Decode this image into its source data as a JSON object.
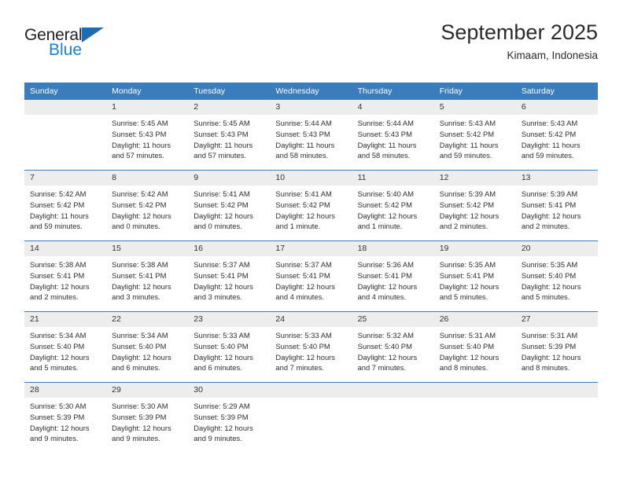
{
  "logo": {
    "word_general": "General",
    "word_blue": "Blue",
    "triangle": "blue-triangle-icon"
  },
  "header": {
    "title": "September 2025",
    "subtitle": "Kimaam, Indonesia"
  },
  "colors": {
    "header_blue": "#3a7dbf",
    "logo_blue": "#1b7fd4",
    "daynum_band": "#ededed",
    "text": "#2e2e2e"
  },
  "weekdays": [
    "Sunday",
    "Monday",
    "Tuesday",
    "Wednesday",
    "Thursday",
    "Friday",
    "Saturday"
  ],
  "weeks": [
    [
      {
        "day": "",
        "blank": true,
        "sunrise": "",
        "sunset": "",
        "daylight_1": "",
        "daylight_2": ""
      },
      {
        "day": "1",
        "sunrise": "Sunrise: 5:45 AM",
        "sunset": "Sunset: 5:43 PM",
        "daylight_1": "Daylight: 11 hours",
        "daylight_2": "and 57 minutes."
      },
      {
        "day": "2",
        "sunrise": "Sunrise: 5:45 AM",
        "sunset": "Sunset: 5:43 PM",
        "daylight_1": "Daylight: 11 hours",
        "daylight_2": "and 57 minutes."
      },
      {
        "day": "3",
        "sunrise": "Sunrise: 5:44 AM",
        "sunset": "Sunset: 5:43 PM",
        "daylight_1": "Daylight: 11 hours",
        "daylight_2": "and 58 minutes."
      },
      {
        "day": "4",
        "sunrise": "Sunrise: 5:44 AM",
        "sunset": "Sunset: 5:43 PM",
        "daylight_1": "Daylight: 11 hours",
        "daylight_2": "and 58 minutes."
      },
      {
        "day": "5",
        "sunrise": "Sunrise: 5:43 AM",
        "sunset": "Sunset: 5:42 PM",
        "daylight_1": "Daylight: 11 hours",
        "daylight_2": "and 59 minutes."
      },
      {
        "day": "6",
        "sunrise": "Sunrise: 5:43 AM",
        "sunset": "Sunset: 5:42 PM",
        "daylight_1": "Daylight: 11 hours",
        "daylight_2": "and 59 minutes."
      }
    ],
    [
      {
        "day": "7",
        "sunrise": "Sunrise: 5:42 AM",
        "sunset": "Sunset: 5:42 PM",
        "daylight_1": "Daylight: 11 hours",
        "daylight_2": "and 59 minutes."
      },
      {
        "day": "8",
        "sunrise": "Sunrise: 5:42 AM",
        "sunset": "Sunset: 5:42 PM",
        "daylight_1": "Daylight: 12 hours",
        "daylight_2": "and 0 minutes."
      },
      {
        "day": "9",
        "sunrise": "Sunrise: 5:41 AM",
        "sunset": "Sunset: 5:42 PM",
        "daylight_1": "Daylight: 12 hours",
        "daylight_2": "and 0 minutes."
      },
      {
        "day": "10",
        "sunrise": "Sunrise: 5:41 AM",
        "sunset": "Sunset: 5:42 PM",
        "daylight_1": "Daylight: 12 hours",
        "daylight_2": "and 1 minute."
      },
      {
        "day": "11",
        "sunrise": "Sunrise: 5:40 AM",
        "sunset": "Sunset: 5:42 PM",
        "daylight_1": "Daylight: 12 hours",
        "daylight_2": "and 1 minute."
      },
      {
        "day": "12",
        "sunrise": "Sunrise: 5:39 AM",
        "sunset": "Sunset: 5:42 PM",
        "daylight_1": "Daylight: 12 hours",
        "daylight_2": "and 2 minutes."
      },
      {
        "day": "13",
        "sunrise": "Sunrise: 5:39 AM",
        "sunset": "Sunset: 5:41 PM",
        "daylight_1": "Daylight: 12 hours",
        "daylight_2": "and 2 minutes."
      }
    ],
    [
      {
        "day": "14",
        "sunrise": "Sunrise: 5:38 AM",
        "sunset": "Sunset: 5:41 PM",
        "daylight_1": "Daylight: 12 hours",
        "daylight_2": "and 2 minutes."
      },
      {
        "day": "15",
        "sunrise": "Sunrise: 5:38 AM",
        "sunset": "Sunset: 5:41 PM",
        "daylight_1": "Daylight: 12 hours",
        "daylight_2": "and 3 minutes."
      },
      {
        "day": "16",
        "sunrise": "Sunrise: 5:37 AM",
        "sunset": "Sunset: 5:41 PM",
        "daylight_1": "Daylight: 12 hours",
        "daylight_2": "and 3 minutes."
      },
      {
        "day": "17",
        "sunrise": "Sunrise: 5:37 AM",
        "sunset": "Sunset: 5:41 PM",
        "daylight_1": "Daylight: 12 hours",
        "daylight_2": "and 4 minutes."
      },
      {
        "day": "18",
        "sunrise": "Sunrise: 5:36 AM",
        "sunset": "Sunset: 5:41 PM",
        "daylight_1": "Daylight: 12 hours",
        "daylight_2": "and 4 minutes."
      },
      {
        "day": "19",
        "sunrise": "Sunrise: 5:35 AM",
        "sunset": "Sunset: 5:41 PM",
        "daylight_1": "Daylight: 12 hours",
        "daylight_2": "and 5 minutes."
      },
      {
        "day": "20",
        "sunrise": "Sunrise: 5:35 AM",
        "sunset": "Sunset: 5:40 PM",
        "daylight_1": "Daylight: 12 hours",
        "daylight_2": "and 5 minutes."
      }
    ],
    [
      {
        "day": "21",
        "sunrise": "Sunrise: 5:34 AM",
        "sunset": "Sunset: 5:40 PM",
        "daylight_1": "Daylight: 12 hours",
        "daylight_2": "and 5 minutes."
      },
      {
        "day": "22",
        "sunrise": "Sunrise: 5:34 AM",
        "sunset": "Sunset: 5:40 PM",
        "daylight_1": "Daylight: 12 hours",
        "daylight_2": "and 6 minutes."
      },
      {
        "day": "23",
        "sunrise": "Sunrise: 5:33 AM",
        "sunset": "Sunset: 5:40 PM",
        "daylight_1": "Daylight: 12 hours",
        "daylight_2": "and 6 minutes."
      },
      {
        "day": "24",
        "sunrise": "Sunrise: 5:33 AM",
        "sunset": "Sunset: 5:40 PM",
        "daylight_1": "Daylight: 12 hours",
        "daylight_2": "and 7 minutes."
      },
      {
        "day": "25",
        "sunrise": "Sunrise: 5:32 AM",
        "sunset": "Sunset: 5:40 PM",
        "daylight_1": "Daylight: 12 hours",
        "daylight_2": "and 7 minutes."
      },
      {
        "day": "26",
        "sunrise": "Sunrise: 5:31 AM",
        "sunset": "Sunset: 5:40 PM",
        "daylight_1": "Daylight: 12 hours",
        "daylight_2": "and 8 minutes."
      },
      {
        "day": "27",
        "sunrise": "Sunrise: 5:31 AM",
        "sunset": "Sunset: 5:39 PM",
        "daylight_1": "Daylight: 12 hours",
        "daylight_2": "and 8 minutes."
      }
    ],
    [
      {
        "day": "28",
        "sunrise": "Sunrise: 5:30 AM",
        "sunset": "Sunset: 5:39 PM",
        "daylight_1": "Daylight: 12 hours",
        "daylight_2": "and 9 minutes."
      },
      {
        "day": "29",
        "sunrise": "Sunrise: 5:30 AM",
        "sunset": "Sunset: 5:39 PM",
        "daylight_1": "Daylight: 12 hours",
        "daylight_2": "and 9 minutes."
      },
      {
        "day": "30",
        "sunrise": "Sunrise: 5:29 AM",
        "sunset": "Sunset: 5:39 PM",
        "daylight_1": "Daylight: 12 hours",
        "daylight_2": "and 9 minutes."
      },
      {
        "day": "",
        "blank": true,
        "sunrise": "",
        "sunset": "",
        "daylight_1": "",
        "daylight_2": ""
      },
      {
        "day": "",
        "blank": true,
        "sunrise": "",
        "sunset": "",
        "daylight_1": "",
        "daylight_2": ""
      },
      {
        "day": "",
        "blank": true,
        "sunrise": "",
        "sunset": "",
        "daylight_1": "",
        "daylight_2": ""
      },
      {
        "day": "",
        "blank": true,
        "sunrise": "",
        "sunset": "",
        "daylight_1": "",
        "daylight_2": ""
      }
    ]
  ]
}
